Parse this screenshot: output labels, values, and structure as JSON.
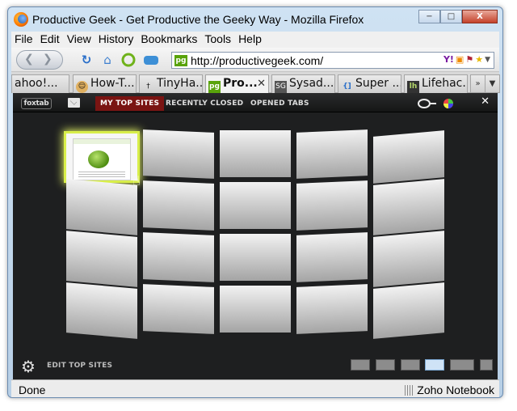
{
  "window": {
    "title": "Productive Geek - Get Productive the Geeky Way - Mozilla Firefox",
    "min_label": "−",
    "max_label": "□",
    "close_label": "X"
  },
  "menu": [
    "File",
    "Edit",
    "View",
    "History",
    "Bookmarks",
    "Tools",
    "Help"
  ],
  "navbar": {
    "url": "http://productivegeek.com/",
    "favicon_text": "pg"
  },
  "tabs": [
    {
      "label": "ahoo!...",
      "icon": "yahoo-favicon",
      "fav": ""
    },
    {
      "label": "How-T...",
      "icon": "howtogeek-favicon",
      "fav": "☺"
    },
    {
      "label": "TinyHa...",
      "icon": "tinyhacker-favicon",
      "fav": "†"
    },
    {
      "label": "Pro...",
      "icon": "pg-favicon",
      "fav": "pg",
      "active": true
    },
    {
      "label": "Sysad...",
      "icon": "sg-favicon",
      "fav": "SG"
    },
    {
      "label": "Super ...",
      "icon": "superuser-favicon",
      "fav": "{]"
    },
    {
      "label": "Lifehac...",
      "icon": "lifehacker-favicon",
      "fav": "lh"
    }
  ],
  "foxtab": {
    "logo": "foxtab",
    "tabs": [
      "MY TOP SITES",
      "RECENTLY CLOSED",
      "OPENED TABS"
    ],
    "active_tab": "MY TOP SITES",
    "close": "✕",
    "edit_label": "EDIT TOP SITES",
    "view_modes": [
      "carousel-view",
      "row-view",
      "grid-view",
      "wall-view",
      "stack-view",
      "flip-view"
    ],
    "active_view": "wall-view"
  },
  "status": {
    "text": "Done",
    "addon": "Zoho Notebook"
  },
  "colors": {
    "accent_red": "#7a1412",
    "highlight": "#d8ee4a",
    "background": "#1e1f20"
  }
}
